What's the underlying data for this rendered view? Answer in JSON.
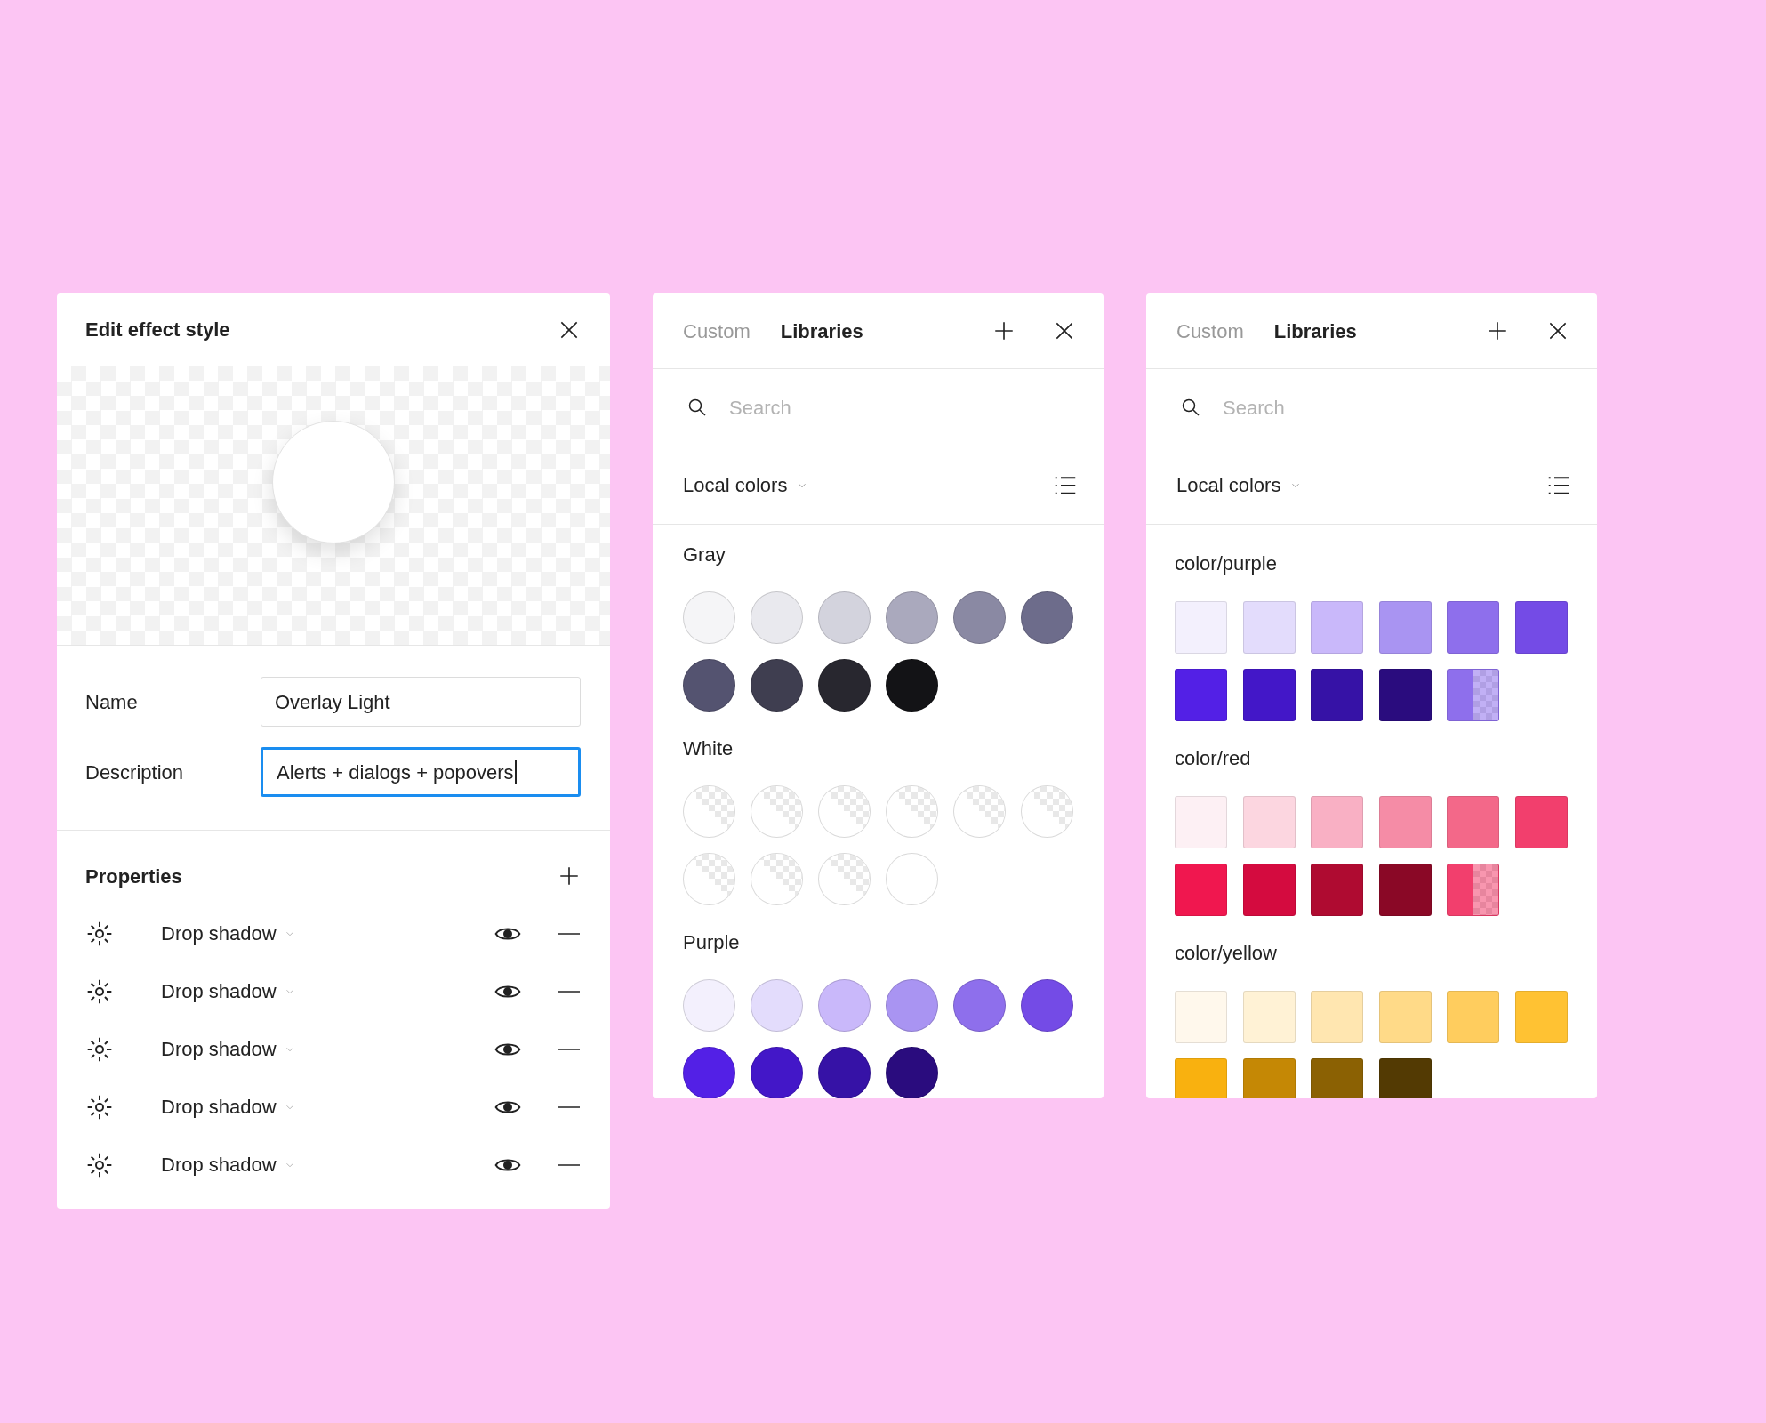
{
  "effect_panel": {
    "title": "Edit effect style",
    "fields": [
      {
        "label": "Name",
        "value": "Overlay Light",
        "focused": false
      },
      {
        "label": "Description",
        "value": "Alerts + dialogs + popovers",
        "focused": true
      }
    ],
    "properties": {
      "title": "Properties",
      "effects": [
        {
          "label": "Drop shadow",
          "visible": true
        },
        {
          "label": "Drop shadow",
          "visible": true
        },
        {
          "label": "Drop shadow",
          "visible": true
        },
        {
          "label": "Drop shadow",
          "visible": true
        },
        {
          "label": "Drop shadow",
          "visible": true
        }
      ]
    }
  },
  "color_pickers": [
    {
      "tabs": [
        {
          "label": "Custom",
          "selected": false
        },
        {
          "label": "Libraries",
          "selected": true
        }
      ],
      "search": {
        "placeholder": "Search"
      },
      "source": "Local colors",
      "kind": "circle",
      "groups": [
        {
          "name": "Gray",
          "swatches": [
            {
              "kind": "solid",
              "color": "#f5f5f7"
            },
            {
              "kind": "solid",
              "color": "#e9e9ee"
            },
            {
              "kind": "solid",
              "color": "#d3d3dd"
            },
            {
              "kind": "solid",
              "color": "#aaa9bd"
            },
            {
              "kind": "solid",
              "color": "#8a89a3"
            },
            {
              "kind": "solid",
              "color": "#6d6c8b"
            },
            {
              "kind": "solid",
              "color": "#545370"
            },
            {
              "kind": "solid",
              "color": "#3f3e50"
            },
            {
              "kind": "solid",
              "color": "#28272f"
            },
            {
              "kind": "solid",
              "color": "#131316"
            }
          ]
        },
        {
          "name": "White",
          "swatches": [
            {
              "kind": "alpha",
              "color": "#ffffff"
            },
            {
              "kind": "alpha",
              "color": "#ffffff"
            },
            {
              "kind": "alpha",
              "color": "#ffffff"
            },
            {
              "kind": "alpha",
              "color": "#ffffff"
            },
            {
              "kind": "alpha",
              "color": "#ffffff"
            },
            {
              "kind": "alpha",
              "color": "#ffffff"
            },
            {
              "kind": "alpha",
              "color": "#ffffff"
            },
            {
              "kind": "alpha",
              "color": "#ffffff"
            },
            {
              "kind": "alpha",
              "color": "#ffffff"
            },
            {
              "kind": "solid",
              "color": "#ffffff"
            }
          ]
        },
        {
          "name": "Purple",
          "swatches": [
            {
              "kind": "solid",
              "color": "#f3f0fd"
            },
            {
              "kind": "solid",
              "color": "#e3dcfc"
            },
            {
              "kind": "solid",
              "color": "#c9b8fa"
            },
            {
              "kind": "solid",
              "color": "#a994f2"
            },
            {
              "kind": "solid",
              "color": "#8e6fec"
            },
            {
              "kind": "solid",
              "color": "#744be6"
            },
            {
              "kind": "solid",
              "color": "#5320e6"
            },
            {
              "kind": "solid",
              "color": "#4317c8"
            },
            {
              "kind": "solid",
              "color": "#3612a6"
            },
            {
              "kind": "solid",
              "color": "#2a0c7e"
            }
          ]
        }
      ]
    },
    {
      "tabs": [
        {
          "label": "Custom",
          "selected": false
        },
        {
          "label": "Libraries",
          "selected": true
        }
      ],
      "search": {
        "placeholder": "Search"
      },
      "source": "Local colors",
      "kind": "square",
      "groups": [
        {
          "name": "color/purple",
          "swatches": [
            {
              "kind": "solid",
              "color": "#f3f0fd"
            },
            {
              "kind": "solid",
              "color": "#e3dcfc"
            },
            {
              "kind": "solid",
              "color": "#c9b8fa"
            },
            {
              "kind": "solid",
              "color": "#a994f2"
            },
            {
              "kind": "solid",
              "color": "#8e6fec"
            },
            {
              "kind": "solid",
              "color": "#744be6"
            },
            {
              "kind": "solid",
              "color": "#5320e6"
            },
            {
              "kind": "solid",
              "color": "#4317c8"
            },
            {
              "kind": "solid",
              "color": "#3612a6"
            },
            {
              "kind": "solid",
              "color": "#2a0c7e"
            },
            {
              "kind": "split",
              "color": "#8e6fec"
            }
          ]
        },
        {
          "name": "color/red",
          "swatches": [
            {
              "kind": "solid",
              "color": "#fdf0f4"
            },
            {
              "kind": "solid",
              "color": "#fcd6e0"
            },
            {
              "kind": "solid",
              "color": "#f9b0c4"
            },
            {
              "kind": "solid",
              "color": "#f58ca6"
            },
            {
              "kind": "solid",
              "color": "#f36889"
            },
            {
              "kind": "solid",
              "color": "#f23f6d"
            },
            {
              "kind": "solid",
              "color": "#f0174f"
            },
            {
              "kind": "solid",
              "color": "#d40b3f"
            },
            {
              "kind": "solid",
              "color": "#af0b31"
            },
            {
              "kind": "solid",
              "color": "#8a0826"
            },
            {
              "kind": "split",
              "color": "#f23f6d"
            }
          ]
        },
        {
          "name": "color/yellow",
          "swatches": [
            {
              "kind": "solid",
              "color": "#fff8ec"
            },
            {
              "kind": "solid",
              "color": "#fff2d5"
            },
            {
              "kind": "solid",
              "color": "#ffe6b0"
            },
            {
              "kind": "solid",
              "color": "#ffda88"
            },
            {
              "kind": "solid",
              "color": "#ffcd5e"
            },
            {
              "kind": "solid",
              "color": "#ffc233"
            },
            {
              "kind": "solid",
              "color": "#f9b10f"
            },
            {
              "kind": "solid",
              "color": "#c58805"
            },
            {
              "kind": "solid",
              "color": "#8b6103"
            },
            {
              "kind": "solid",
              "color": "#533a03"
            }
          ]
        }
      ]
    }
  ]
}
